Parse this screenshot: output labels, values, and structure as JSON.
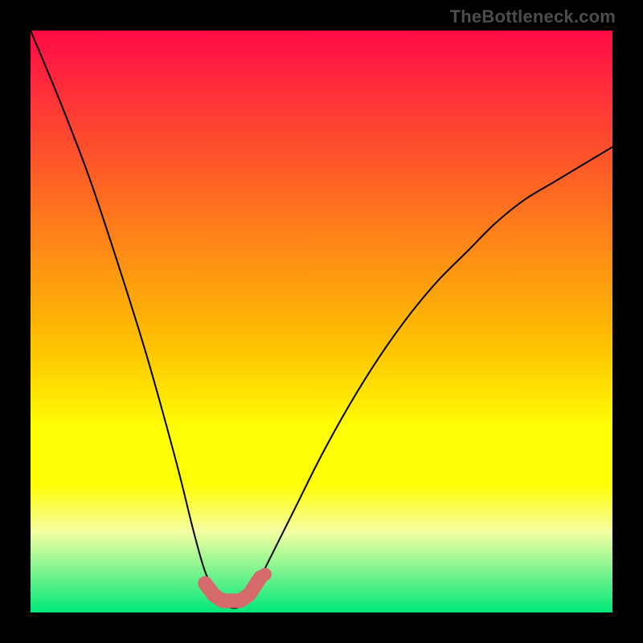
{
  "watermark": "TheBottleneck.com",
  "colors": {
    "gradient_top": "#fe0b46",
    "gradient_mid1": "#fec500",
    "gradient_mid2": "#fffd05",
    "gradient_mid3": "#f6ffa2",
    "gradient_bottom": "#00e879",
    "curve": "#000000",
    "marker_fill": "#d56a6d",
    "marker_stroke": "#d56a6d"
  },
  "chart_data": {
    "type": "line",
    "title": "",
    "xlabel": "",
    "ylabel": "",
    "xlim": [
      0,
      100
    ],
    "ylim": [
      0,
      100
    ],
    "grid": false,
    "series": [
      {
        "name": "bottleneck-curve",
        "x": [
          0,
          5,
          10,
          15,
          20,
          25,
          28,
          30,
          32,
          34,
          36,
          38,
          40,
          45,
          50,
          55,
          60,
          65,
          70,
          75,
          80,
          85,
          90,
          95,
          100
        ],
        "y": [
          100,
          88,
          75,
          60,
          44,
          26,
          14,
          7,
          3,
          1,
          1,
          3,
          7,
          17,
          27,
          36,
          44,
          51,
          57,
          62,
          67,
          71,
          74,
          77,
          80
        ]
      }
    ],
    "markers": {
      "name": "highlight-markers",
      "x": [
        30,
        31.5,
        33,
        34.5,
        36,
        37.5,
        39.5
      ],
      "y": [
        5,
        3,
        2,
        2,
        2,
        3,
        6
      ]
    },
    "gradient_background": {
      "stops": [
        {
          "offset": 0.0,
          "color": "#fe0b46"
        },
        {
          "offset": 0.55,
          "color": "#fec500"
        },
        {
          "offset": 0.68,
          "color": "#fffd05"
        },
        {
          "offset": 0.78,
          "color": "#fffd05"
        },
        {
          "offset": 0.86,
          "color": "#f6ffa2"
        },
        {
          "offset": 1.0,
          "color": "#00e879"
        }
      ]
    }
  }
}
